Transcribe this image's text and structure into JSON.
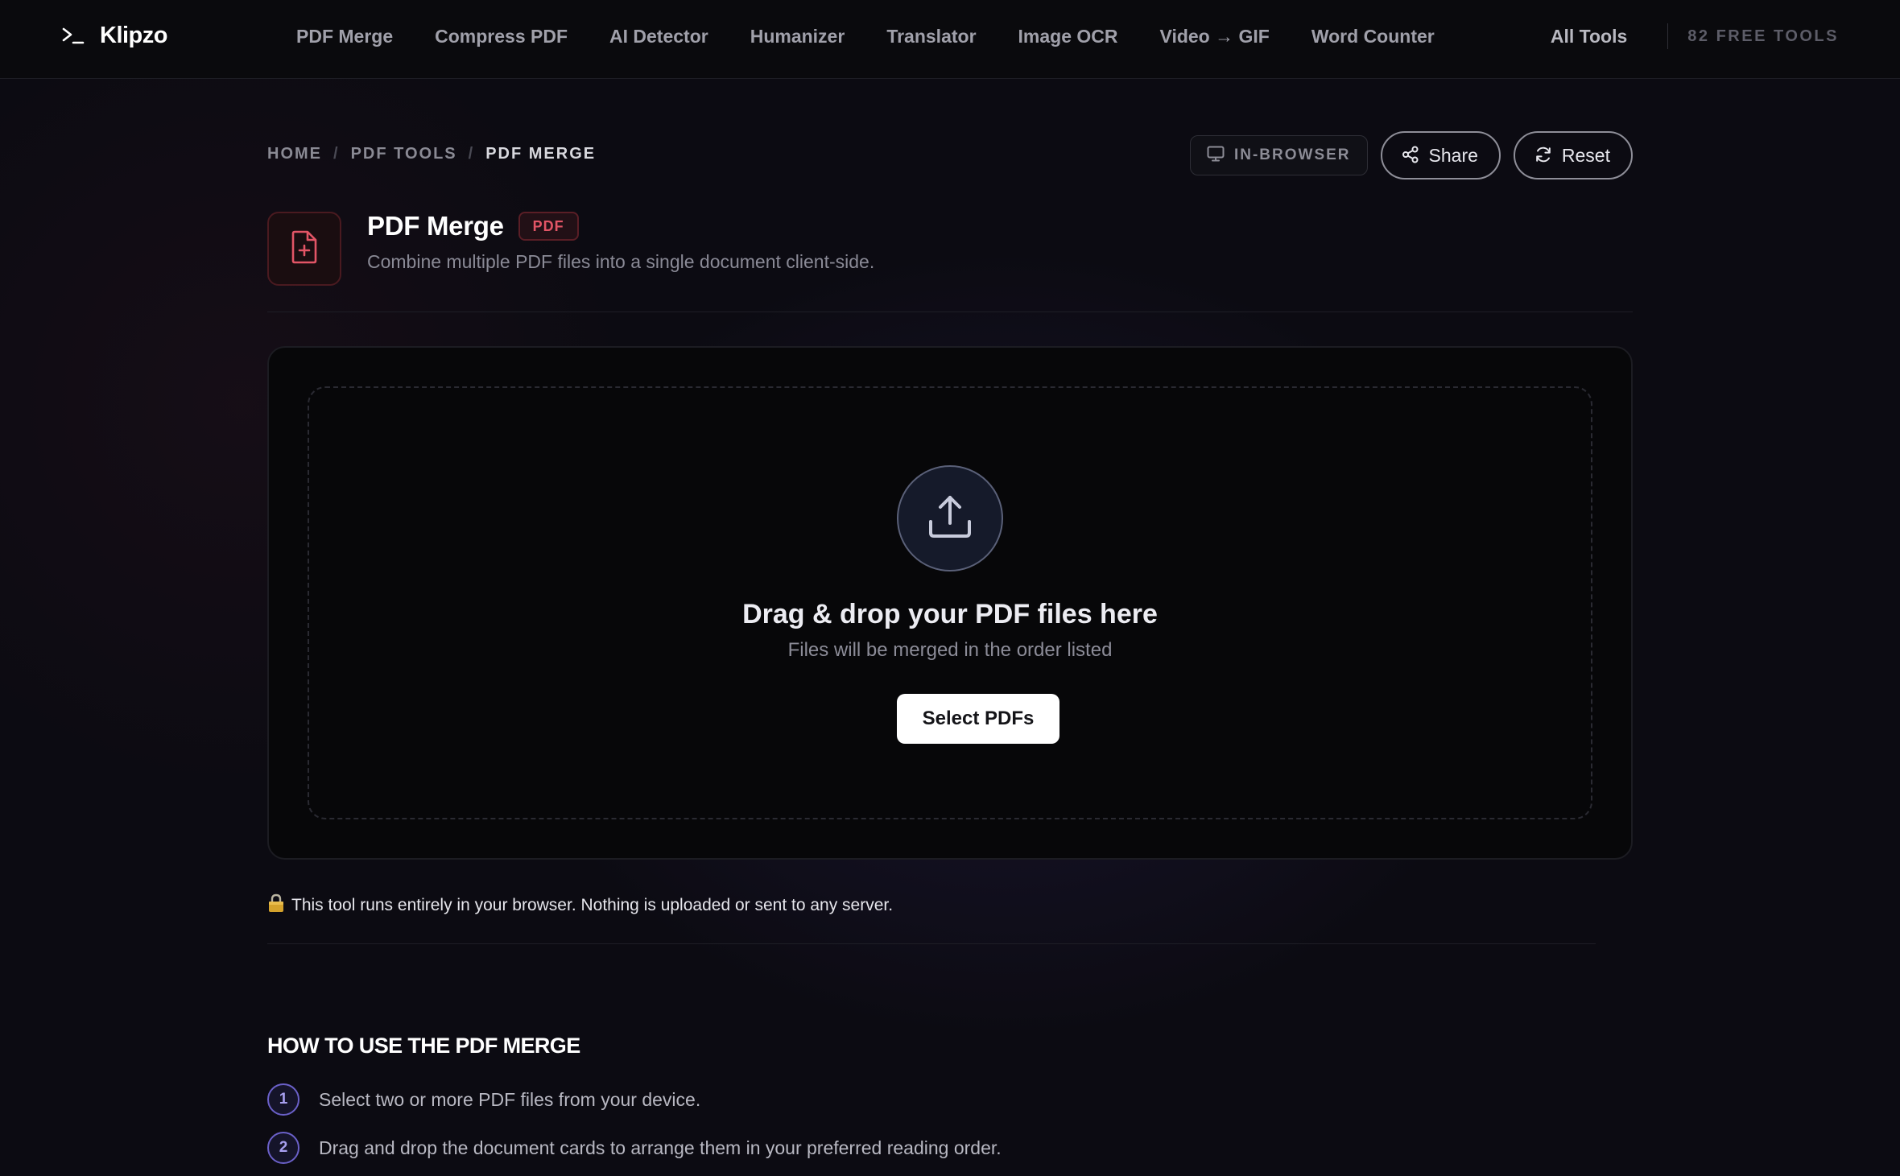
{
  "nav": {
    "logo_text": "Klipzo",
    "links": [
      "PDF Merge",
      "Compress PDF",
      "AI Detector",
      "Humanizer",
      "Translator",
      "Image OCR",
      "Video → GIF",
      "Word Counter"
    ],
    "all_tools": "All Tools",
    "free_tools": "82 FREE TOOLS"
  },
  "breadcrumb": {
    "home": "HOME",
    "section": "PDF TOOLS",
    "current": "PDF MERGE",
    "separator": "/"
  },
  "actions": {
    "in_browser": "IN-BROWSER",
    "share": "Share",
    "reset": "Reset"
  },
  "tool": {
    "title": "PDF Merge",
    "tag": "PDF",
    "subtitle": "Combine multiple PDF files into a single document client-side."
  },
  "upload": {
    "title": "Drag & drop your PDF files here",
    "subtitle": "Files will be merged in the order listed",
    "button": "Select PDFs"
  },
  "privacy_note": "This tool runs entirely in your browser. Nothing is uploaded or sent to any server.",
  "howto": {
    "title": "HOW TO USE THE PDF MERGE",
    "steps": [
      {
        "num": "1",
        "text": "Select two or more PDF files from your device."
      },
      {
        "num": "2",
        "text": "Drag and drop the document cards to arrange them in your preferred reading order."
      }
    ]
  },
  "colors": {
    "accent_red": "#e25566",
    "accent_purple": "#6a60c8",
    "background": "#0c0b12"
  }
}
